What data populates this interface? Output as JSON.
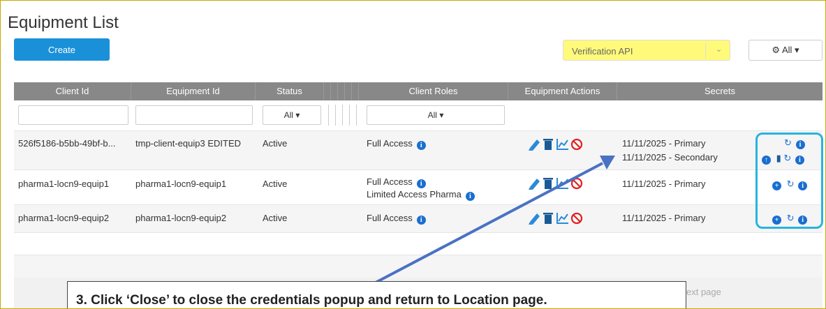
{
  "page": {
    "title": "Equipment List"
  },
  "toolbar": {
    "create_label": "Create",
    "api_select_value": "Verification API",
    "filter_all_label": "All"
  },
  "table": {
    "columns": [
      "Client Id",
      "Equipment Id",
      "Status",
      "Client Roles",
      "Equipment Actions",
      "Secrets"
    ],
    "filters": {
      "status_value": "All",
      "roles_value": "All"
    },
    "rows": [
      {
        "client_id": "526f5186-b5bb-49bf-b...",
        "equipment_id": "tmp-client-equip3 EDITED",
        "status": "Active",
        "roles": [
          "Full Access"
        ],
        "secrets": [
          "11/11/2025 - Primary",
          "11/11/2025 - Secondary"
        ]
      },
      {
        "client_id": "pharma1-locn9-equip1",
        "equipment_id": "pharma1-locn9-equip1",
        "status": "Active",
        "roles": [
          "Full Access",
          "Limited Access Pharma"
        ],
        "secrets": [
          "11/11/2025 - Primary"
        ]
      },
      {
        "client_id": "pharma1-locn9-equip2",
        "equipment_id": "pharma1-locn9-equip2",
        "status": "Active",
        "roles": [
          "Full Access"
        ],
        "secrets": [
          "11/11/2025 - Primary"
        ]
      }
    ]
  },
  "pager": {
    "next_label": "Next page",
    "next_visible": "ext page"
  },
  "callout": {
    "text": "3. Click ‘Close’ to close the credentials popup and return to Location page."
  },
  "colors": {
    "primary": "#1a90d9",
    "header": "#888888",
    "highlight": "#26b4e0",
    "arrow": "#4a72c4",
    "marker": "#fffa7a"
  }
}
